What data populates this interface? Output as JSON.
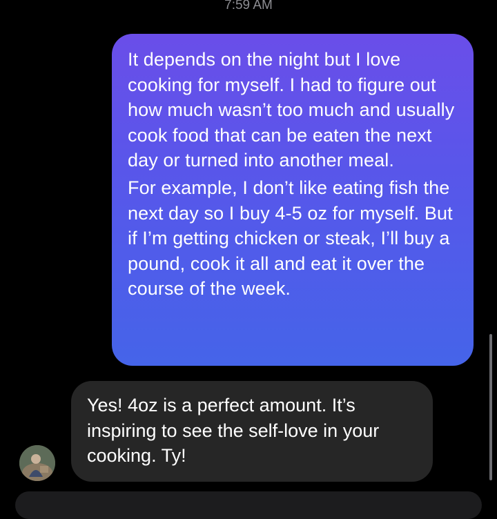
{
  "conversation": {
    "timestamp": "7:59 AM",
    "outgoing_message": {
      "paragraph_1": "It depends on the night but I love cooking for myself. I had to figure out how much wasn’t too much and usually cook food that can be eaten the next day or turned into another meal.",
      "paragraph_2": "For example, I don’t like eating fish the next day so I buy 4-5 oz for myself. But if I’m getting chicken or steak, I’ll buy a pound, cook it all and eat it over the course of the week."
    },
    "incoming_message": {
      "text": "Yes! 4oz is a perfect amount. It’s inspiring to see the self-love in your cooking. Ty!"
    }
  },
  "colors": {
    "background": "#000000",
    "outgoing_gradient_top": "#6a4ee9",
    "outgoing_gradient_bottom": "#4564e9",
    "incoming_bubble": "#262626",
    "timestamp": "#8e8e93"
  }
}
